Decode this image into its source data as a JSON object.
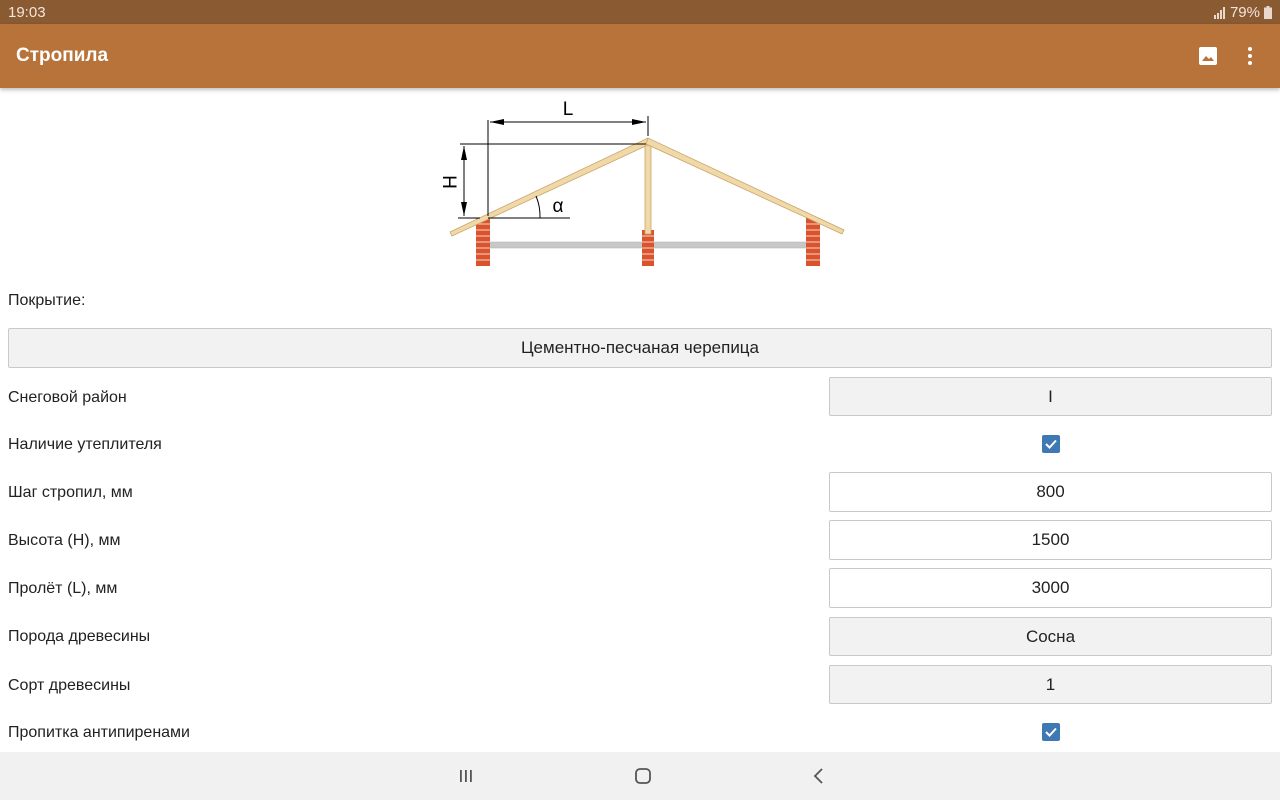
{
  "status": {
    "time": "19:03",
    "battery": "79%"
  },
  "appbar": {
    "title": "Стропила",
    "icons": [
      "image-icon",
      "more-vert-icon"
    ]
  },
  "diagram": {
    "label_l": "L",
    "label_h": "H",
    "label_alpha": "α"
  },
  "form": {
    "covering_label": "Покрытие:",
    "covering_value": "Цементно-песчаная черепица",
    "snow_label": "Снеговой район",
    "snow_value": "I",
    "insulation_label": "Наличие утеплителя",
    "insulation_checked": true,
    "step_label": "Шаг стропил, мм",
    "step_value": "800",
    "height_label": "Высота (H), мм",
    "height_value": "1500",
    "span_label": "Пролёт (L), мм",
    "span_value": "3000",
    "wood_label": "Порода древесины",
    "wood_value": "Сосна",
    "grade_label": "Сорт древесины",
    "grade_value": "1",
    "fireproof_label": "Пропитка антипиренами",
    "fireproof_checked": true
  },
  "colors": {
    "statusbar": "#8a5a33",
    "appbar": "#b8733a",
    "checkbox": "#3f79b4",
    "brick": "#d9542c",
    "rafter": "#f0d8a8"
  },
  "navbar": {
    "icons": [
      "recent-apps-icon",
      "home-icon",
      "back-icon"
    ]
  }
}
